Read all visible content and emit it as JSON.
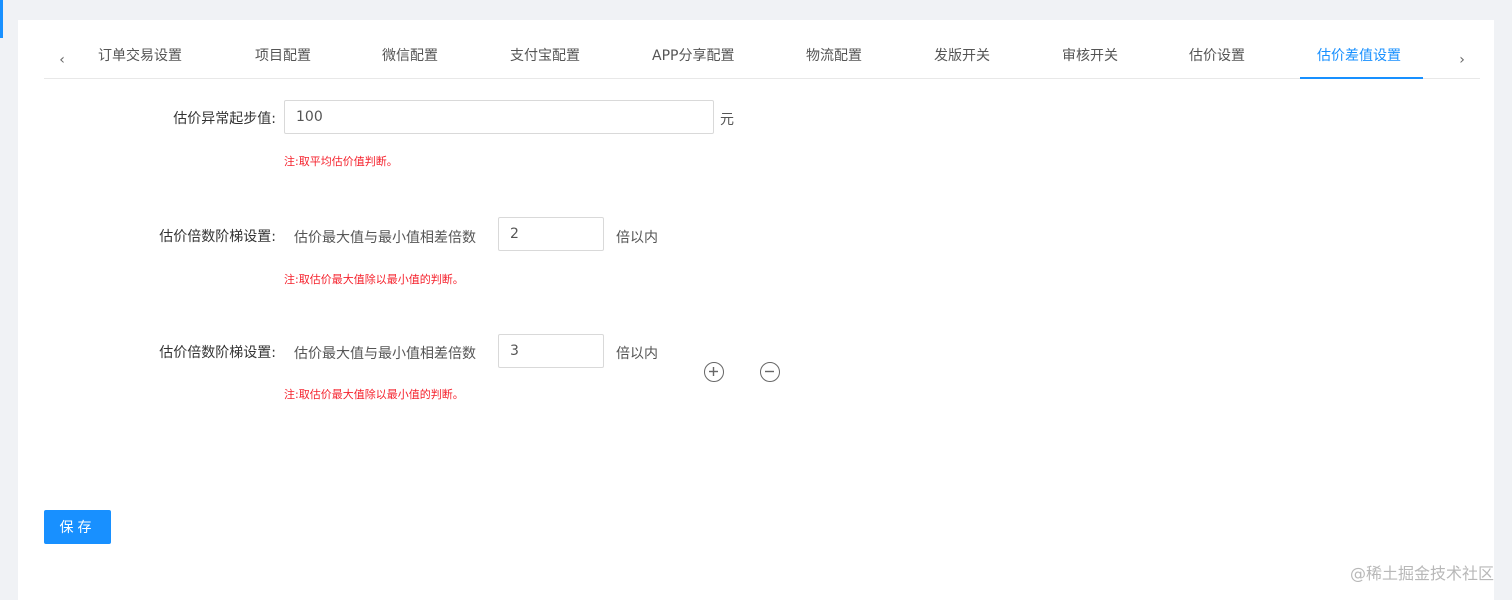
{
  "tabs": {
    "prev_icon": "‹",
    "next_icon": "›",
    "items": [
      {
        "label": "订单交易设置"
      },
      {
        "label": "项目配置"
      },
      {
        "label": "微信配置"
      },
      {
        "label": "支付宝配置"
      },
      {
        "label": "APP分享配置"
      },
      {
        "label": "物流配置"
      },
      {
        "label": "发版开关"
      },
      {
        "label": "审核开关"
      },
      {
        "label": "估价设置"
      },
      {
        "label": "估价差值设置"
      }
    ],
    "active_index": 9
  },
  "form": {
    "start_value": {
      "label": "估价异常起步值:",
      "value": "100",
      "unit": "元",
      "note": "注:取平均估价值判断。"
    },
    "ladders": [
      {
        "label": "估价倍数阶梯设置:",
        "prefix": "估价最大值与最小值相差倍数",
        "value": "2",
        "suffix": "倍以内",
        "note": "注:取估价最大值除以最小值的判断。"
      },
      {
        "label": "估价倍数阶梯设置:",
        "prefix": "估价最大值与最小值相差倍数",
        "value": "3",
        "suffix": "倍以内",
        "note": "注:取估价最大值除以最小值的判断。"
      }
    ]
  },
  "actions": {
    "add_icon": "plus-circle-icon",
    "remove_icon": "minus-circle-icon",
    "save_label": "保存"
  },
  "watermark": "@稀土掘金技术社区",
  "colors": {
    "accent": "#1890ff",
    "note": "#f5222d"
  }
}
